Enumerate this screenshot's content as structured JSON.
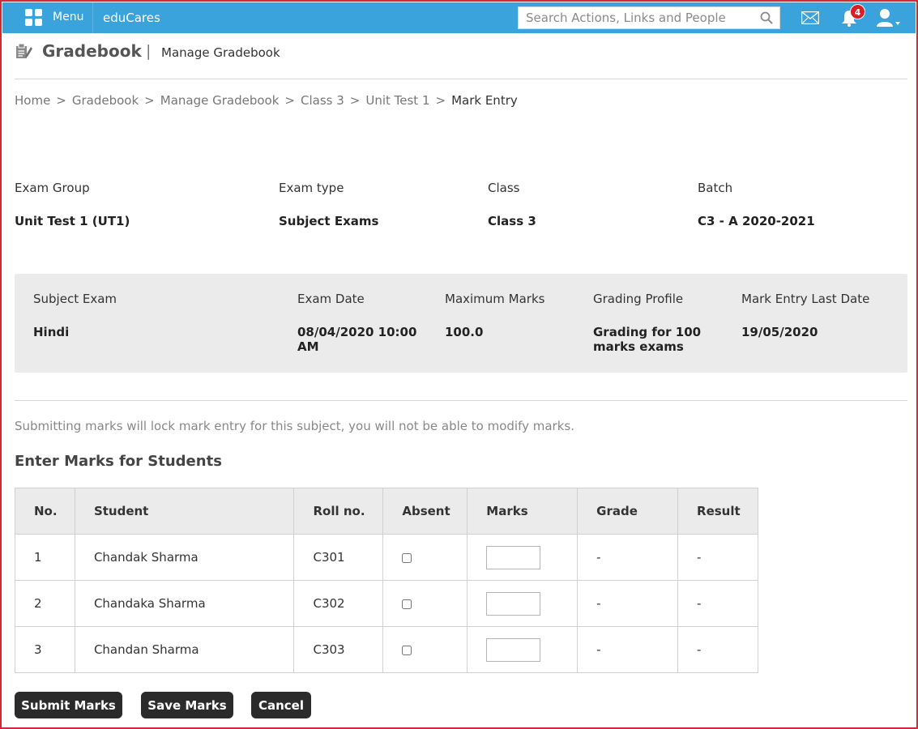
{
  "topbar": {
    "menu_label": "Menu",
    "brand": "eduCares",
    "search_placeholder": "Search Actions, Links and People",
    "notification_count": "4",
    "bar_color": "#3ba3db",
    "badge_color": "#d81f26"
  },
  "header": {
    "title": "Gradebook",
    "separator": "|",
    "subtitle": "Manage Gradebook"
  },
  "breadcrumb": {
    "items": [
      "Home",
      "Gradebook",
      "Manage Gradebook",
      "Class 3",
      "Unit Test 1",
      "Mark Entry"
    ],
    "separator": ">"
  },
  "info": {
    "exam_group_label": "Exam Group",
    "exam_group_value": "Unit Test 1 (UT1)",
    "exam_type_label": "Exam type",
    "exam_type_value": "Subject Exams",
    "class_label": "Class",
    "class_value": "Class 3",
    "batch_label": "Batch",
    "batch_value": "C3 - A 2020-2021"
  },
  "subject": {
    "subject_exam_label": "Subject Exam",
    "subject_exam_value": "Hindi",
    "exam_date_label": "Exam Date",
    "exam_date_value": "08/04/2020 10:00 AM",
    "max_marks_label": "Maximum Marks",
    "max_marks_value": "100.0",
    "grading_profile_label": "Grading Profile",
    "grading_profile_value": "Grading for 100 marks exams",
    "last_date_label": "Mark Entry Last Date",
    "last_date_value": "19/05/2020"
  },
  "notice": "Submitting marks will lock mark entry for this subject, you will not be able to modify marks.",
  "section_title": "Enter Marks for Students",
  "table": {
    "headers": {
      "no": "No.",
      "student": "Student",
      "roll": "Roll no.",
      "absent": "Absent",
      "marks": "Marks",
      "grade": "Grade",
      "result": "Result"
    },
    "rows": [
      {
        "no": "1",
        "student": "Chandak Sharma",
        "roll": "C301",
        "marks": "",
        "grade": "-",
        "result": "-"
      },
      {
        "no": "2",
        "student": "Chandaka Sharma",
        "roll": "C302",
        "marks": "",
        "grade": "-",
        "result": "-"
      },
      {
        "no": "3",
        "student": "Chandan Sharma",
        "roll": "C303",
        "marks": "",
        "grade": "-",
        "result": "-"
      }
    ]
  },
  "buttons": {
    "submit": "Submit Marks",
    "save": "Save Marks",
    "cancel": "Cancel"
  }
}
